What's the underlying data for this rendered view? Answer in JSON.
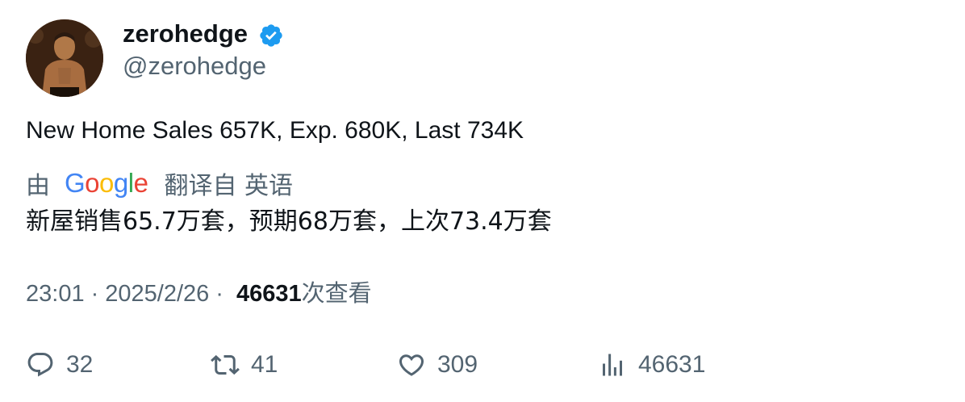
{
  "author": {
    "display_name": "zerohedge",
    "handle": "@zerohedge",
    "verified": true,
    "verified_color": "#1d9bf0"
  },
  "tweet": {
    "text": "New Home Sales 657K, Exp. 680K, Last 734K"
  },
  "translation": {
    "prefix": "由",
    "provider_logo": "Google",
    "suffix": "翻译自 英语",
    "text": "新屋销售65.7万套，预期68万套，上次73.4万套"
  },
  "meta": {
    "time": "23:01",
    "separator": "·",
    "date": "2025/2/26",
    "views_count": "46631",
    "views_label": "次查看"
  },
  "actions": {
    "replies": "32",
    "retweets": "41",
    "likes": "309",
    "views": "46631"
  },
  "icons": {
    "reply": "reply-icon",
    "retweet": "retweet-icon",
    "like": "heart-icon",
    "views": "analytics-icon",
    "verified": "verified-badge-icon"
  }
}
